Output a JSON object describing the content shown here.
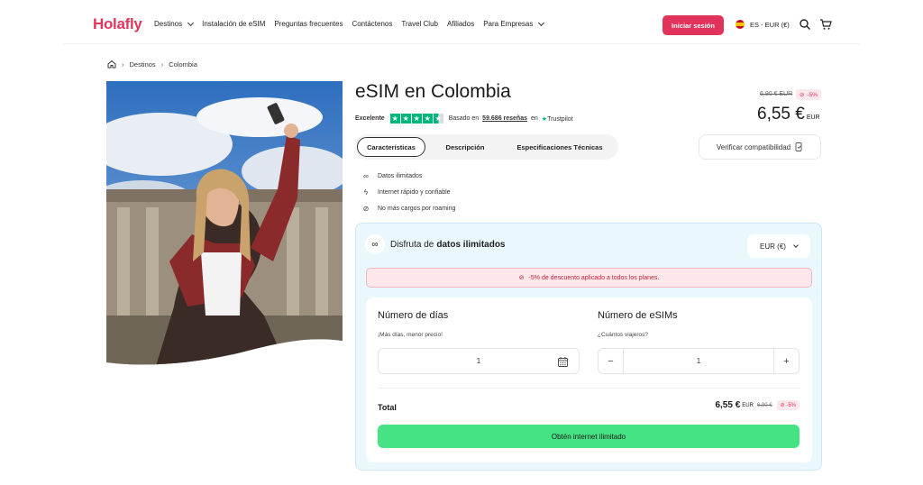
{
  "header": {
    "logo": "Holafly",
    "nav": [
      {
        "label": "Destinos",
        "dropdown": true
      },
      {
        "label": "Instalación de eSIM",
        "dropdown": false
      },
      {
        "label": "Preguntas frecuentes",
        "dropdown": false
      },
      {
        "label": "Contáctenos",
        "dropdown": false
      },
      {
        "label": "Travel Club",
        "dropdown": false
      },
      {
        "label": "Afiliados",
        "dropdown": false
      },
      {
        "label": "Para Empresas",
        "dropdown": true
      }
    ],
    "login_label": "Iniciar sesión",
    "language_label": "ES - EUR (€)",
    "icons": [
      "search-icon",
      "cart-icon"
    ]
  },
  "breadcrumb": [
    "Destinos",
    "Colombia"
  ],
  "product": {
    "title": "eSIM en Colombia",
    "rating_word": "Excelente",
    "rating_stars": 4.5,
    "reviews_prefix": "Basado en",
    "reviews_count": "59.686 reseñas",
    "reviews_suffix": "en",
    "trustpilot": "Trustpilot",
    "old_price": "6,90 € EUR",
    "discount": "-5%",
    "price": "6,55 €",
    "price_currency": "EUR"
  },
  "tabs": [
    {
      "label": "Características",
      "active": true
    },
    {
      "label": "Descripción",
      "active": false
    },
    {
      "label": "Especificaciones Técnicas",
      "active": false
    }
  ],
  "verify_label": "Verificar compatibilidad",
  "features": [
    {
      "icon": "infinity-icon",
      "label": "Datos ilimitados"
    },
    {
      "icon": "bolt-icon",
      "label": "Internet rápido y confiable"
    },
    {
      "icon": "no-roaming-icon",
      "label": "No más cargos por roaming"
    }
  ],
  "plan": {
    "heading_prefix": "Disfruta de",
    "heading_bold": "datos ilimitados",
    "currency_select": "EUR (€)",
    "discount_notice": "-5% de descuento aplicado a todos los planes.",
    "days_label": "Número de días",
    "days_sub": "¡Más días, menor precio!",
    "days_value": "1",
    "esims_label": "Número de eSIMs",
    "esims_sub": "¿Cuántos viajeros?",
    "esims_value": "1",
    "total_label": "Total",
    "total_price": "6,55 €",
    "total_currency": "EUR",
    "total_old": "6,90 €",
    "total_badge": "-5%",
    "cta_label": "Obtén internet ilimitado"
  },
  "colors": {
    "brand": "#e0325a",
    "cta": "#45e383",
    "trustpilot": "#00b67a",
    "card_bg": "#eaf7fc"
  }
}
